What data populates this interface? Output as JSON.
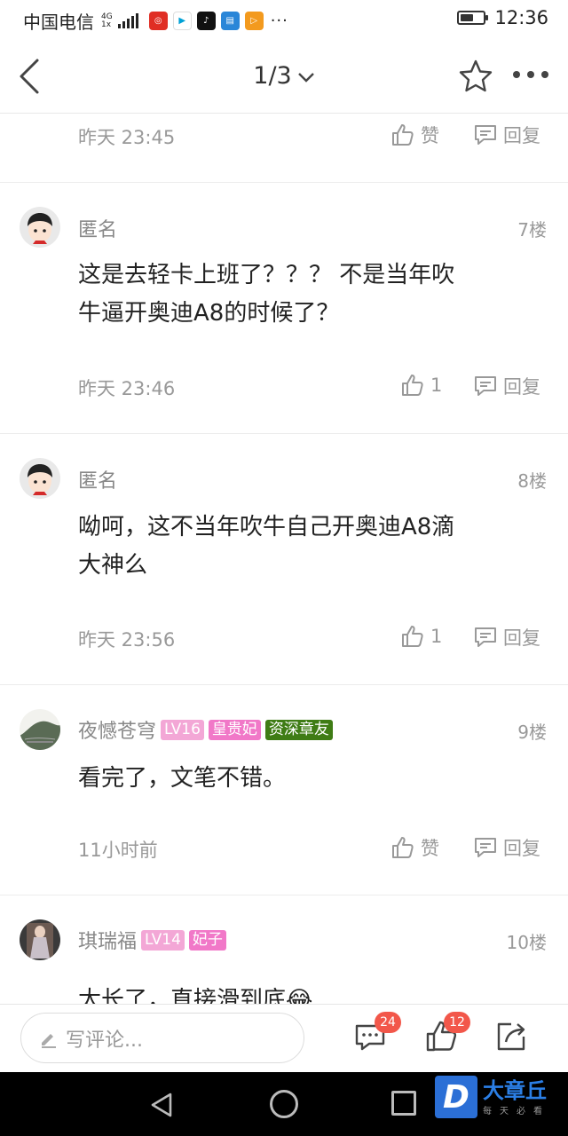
{
  "status_bar": {
    "carrier": "中国电信",
    "network_top": "4G",
    "network_bottom": "1x",
    "app_icons": [
      "netease-music-icon",
      "bilibili-icon",
      "tiktok-icon",
      "news-icon",
      "video-icon"
    ],
    "more": "···",
    "time": "12:36",
    "battery_level": 0.55
  },
  "nav": {
    "page_indicator": "1/3"
  },
  "comments": [
    {
      "partial": true,
      "time": "昨天 23:45",
      "like_label": "赞",
      "reply_label": "回复"
    },
    {
      "user": "匿名",
      "badges": [],
      "floor": "7楼",
      "lines": [
        "这是去轻卡上班了？？？ 不是当年吹",
        "牛逼开奥迪A8的时候了？"
      ],
      "time": "昨天 23:46",
      "like_label": "1",
      "reply_label": "回复"
    },
    {
      "user": "匿名",
      "badges": [],
      "floor": "8楼",
      "lines": [
        "呦呵，这不当年吹牛自己开奥迪A8滴",
        "大神么"
      ],
      "time": "昨天 23:56",
      "like_label": "1",
      "reply_label": "回复"
    },
    {
      "user": "夜憾苍穹",
      "badges": [
        "LV16",
        "皇贵妃",
        "资深章友"
      ],
      "floor": "9楼",
      "lines": [
        "看完了，文笔不错。"
      ],
      "time": "11小时前",
      "like_label": "赞",
      "reply_label": "回复"
    },
    {
      "user": "琪瑞福",
      "badges": [
        "LV14",
        "妃子"
      ],
      "floor": "10楼",
      "lines": [
        "太长了，直接滑到底😂"
      ],
      "partial": true
    }
  ],
  "bottom_bar": {
    "input_placeholder": "写评论...",
    "comment_count": "24",
    "like_count": "12"
  },
  "logo": {
    "mark": "D",
    "name": "大章丘",
    "tagline": "每天必看"
  },
  "colors": {
    "badge_red": "#f2574a",
    "badge_level": "#f3a7d6",
    "badge_title": "#f178c8",
    "badge_senior": "#3f7c15",
    "logo_blue": "#2b6fd6"
  }
}
